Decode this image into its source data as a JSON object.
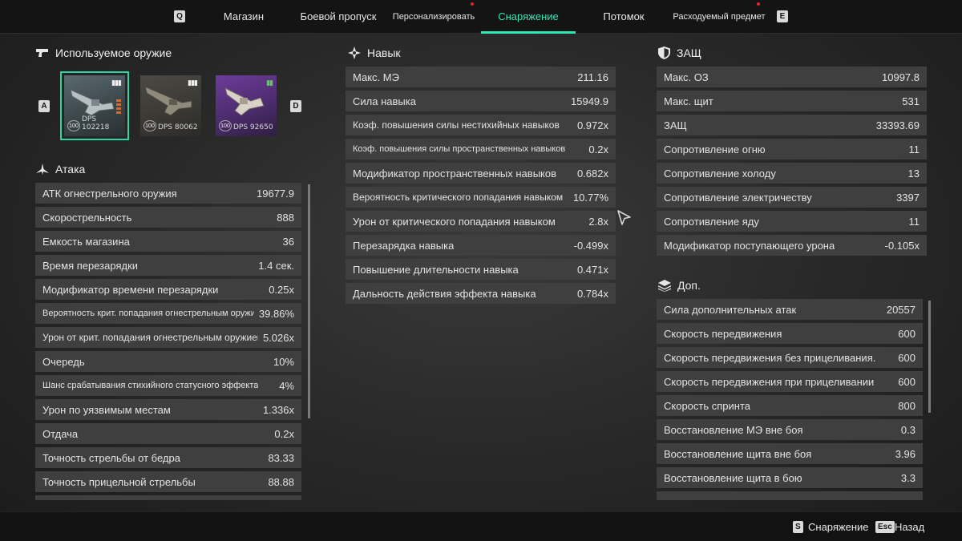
{
  "nav": {
    "key_left": "Q",
    "key_right": "E",
    "tabs": [
      {
        "label": "Магазин",
        "dot": false
      },
      {
        "label": "Боевой пропуск",
        "dot": false
      },
      {
        "label": "Персонализировать",
        "dot": true
      },
      {
        "label": "Снаряжение",
        "dot": false,
        "active": true
      },
      {
        "label": "Потомок",
        "dot": false
      },
      {
        "label": "Расходуемый предмет",
        "dot": true
      }
    ]
  },
  "weapons": {
    "title": "Используемое оружие",
    "key_prev": "A",
    "key_next": "D",
    "slots": [
      {
        "level": "100",
        "dps": "DPS 102218",
        "selected": true,
        "tier": "grey"
      },
      {
        "level": "100",
        "dps": "DPS 80062",
        "selected": false,
        "tier": "grey"
      },
      {
        "level": "100",
        "dps": "DPS 92650",
        "selected": false,
        "tier": "purple"
      }
    ]
  },
  "attack": {
    "title": "Атака",
    "rows": [
      {
        "label": "АТК огнестрельного оружия",
        "value": "19677.9"
      },
      {
        "label": "Скорострельность",
        "value": "888"
      },
      {
        "label": "Емкость магазина",
        "value": "36"
      },
      {
        "label": "Время перезарядки",
        "value": "1.4 сек."
      },
      {
        "label": "Модификатор времени перезарядки",
        "value": "0.25x"
      },
      {
        "label": "Вероятность крит. попадания огнестрельным оружием",
        "value": "39.86%"
      },
      {
        "label": "Урон от крит. попадания огнестрельным оружием",
        "value": "5.026x"
      },
      {
        "label": "Очередь",
        "value": "10%"
      },
      {
        "label": "Шанс срабатывания стихийного статусного эффекта",
        "value": "4%"
      },
      {
        "label": "Урон по уязвимым местам",
        "value": "1.336x"
      },
      {
        "label": "Отдача",
        "value": "0.2x"
      },
      {
        "label": "Точность стрельбы от бедра",
        "value": "83.33"
      },
      {
        "label": "Точность прицельной стрельбы",
        "value": "88.88"
      }
    ]
  },
  "skill": {
    "title": "Навык",
    "rows": [
      {
        "label": "Макс. МЭ",
        "value": "211.16"
      },
      {
        "label": "Сила навыка",
        "value": "15949.9"
      },
      {
        "label": "Коэф. повышения силы нестихийных навыков",
        "value": "0.972x"
      },
      {
        "label": "Коэф. повышения силы пространственных навыков",
        "value": "0.2x"
      },
      {
        "label": "Модификатор пространственных навыков",
        "value": "0.682x"
      },
      {
        "label": "Вероятность критического попадания навыком",
        "value": "10.77%"
      },
      {
        "label": "Урон от критического попадания навыком",
        "value": "2.8x"
      },
      {
        "label": "Перезарядка навыка",
        "value": "-0.499x"
      },
      {
        "label": "Повышение длительности навыка",
        "value": "0.471x"
      },
      {
        "label": "Дальность действия эффекта навыка",
        "value": "0.784x"
      }
    ]
  },
  "defense": {
    "title": "ЗАЩ",
    "rows": [
      {
        "label": "Макс. ОЗ",
        "value": "10997.8"
      },
      {
        "label": "Макс. щит",
        "value": "531"
      },
      {
        "label": "ЗАЩ",
        "value": "33393.69"
      },
      {
        "label": "Сопротивление огню",
        "value": "11"
      },
      {
        "label": "Сопротивление холоду",
        "value": "13"
      },
      {
        "label": "Сопротивление электричеству",
        "value": "3397"
      },
      {
        "label": "Сопротивление яду",
        "value": "11"
      },
      {
        "label": "Модификатор поступающего урона",
        "value": "-0.105x"
      }
    ]
  },
  "extra": {
    "title": "Доп.",
    "rows": [
      {
        "label": "Сила дополнительных атак",
        "value": "20557"
      },
      {
        "label": "Скорость передвижения",
        "value": "600"
      },
      {
        "label": "Скорость передвижения без прицеливания.",
        "value": "600"
      },
      {
        "label": "Скорость передвижения при прицеливании",
        "value": "600"
      },
      {
        "label": "Скорость спринта",
        "value": "800"
      },
      {
        "label": "Восстановление МЭ вне боя",
        "value": "0.3"
      },
      {
        "label": "Восстановление щита вне боя",
        "value": "3.96"
      },
      {
        "label": "Восстановление щита в бою",
        "value": "3.3"
      }
    ]
  },
  "footer": {
    "key1": "S",
    "label1": "Снаряжение",
    "key2": "Esc",
    "label2": "Назад"
  },
  "colors": {
    "accent": "#2ee8b6",
    "notify_dot": "#e3232c",
    "row_bg": "#3f3f3f"
  }
}
